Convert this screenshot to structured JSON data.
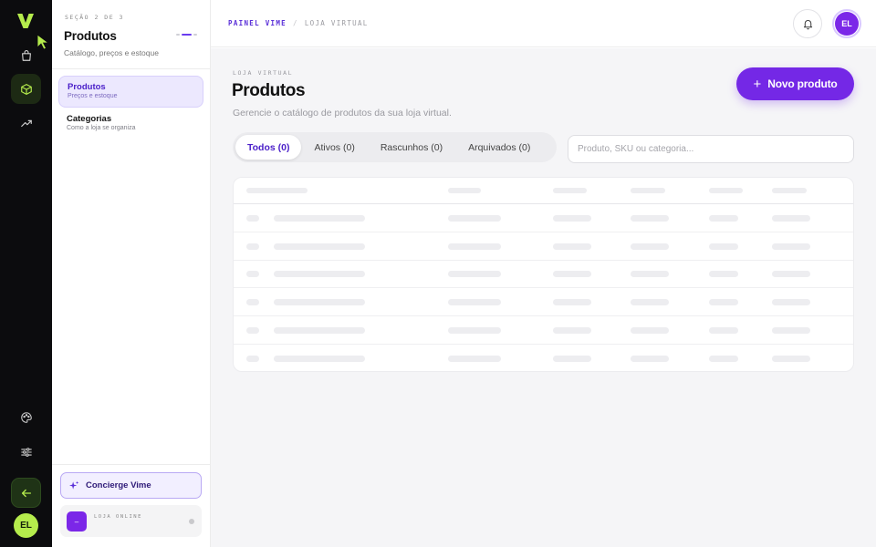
{
  "rail": {
    "items": [
      {
        "name": "store-icon"
      },
      {
        "name": "box-icon",
        "active": true
      },
      {
        "name": "trend-icon"
      }
    ],
    "bottom": [
      {
        "name": "palette-icon"
      },
      {
        "name": "sliders-icon"
      },
      {
        "name": "arrow-left-icon"
      }
    ],
    "avatar": "EL",
    "accent": "#b5ec4c"
  },
  "sidebar": {
    "eyebrow": "SEÇÃO 2 DE 3",
    "title": "Produtos",
    "subtitle": "Catálogo, preços e estoque",
    "items": [
      {
        "label": "Produtos",
        "desc": "Preços e estoque",
        "active": true
      },
      {
        "label": "Categorias",
        "desc": "Como a loja se organiza",
        "active": false
      }
    ],
    "concierge": "Concierge Vime",
    "store": {
      "icon": "–",
      "label": "LOJA ONLINE"
    }
  },
  "topbar": {
    "crumb_root": "PAINEL VIME",
    "crumb_sep": "/",
    "crumb_current": "LOJA VIRTUAL",
    "avatar": "EL"
  },
  "main": {
    "eyebrow": "LOJA VIRTUAL",
    "title": "Produtos",
    "subtitle": "Gerencie o catálogo de produtos da sua loja virtual.",
    "new_button": "Novo produto",
    "new_button_icon": "+",
    "tabs": [
      {
        "label": "Todos (0)",
        "active": true
      },
      {
        "label": "Ativos (0)",
        "active": false
      },
      {
        "label": "Rascunhos (0)",
        "active": false
      },
      {
        "label": "Arquivados (0)",
        "active": false
      }
    ],
    "search_placeholder": "Produto, SKU ou categoria...",
    "skeleton_rows": 6
  },
  "colors": {
    "brand": "#7428e6",
    "brand_dark": "#4a1fc9",
    "rail_bg": "#0c0c0e",
    "lime": "#b5ec4c"
  }
}
